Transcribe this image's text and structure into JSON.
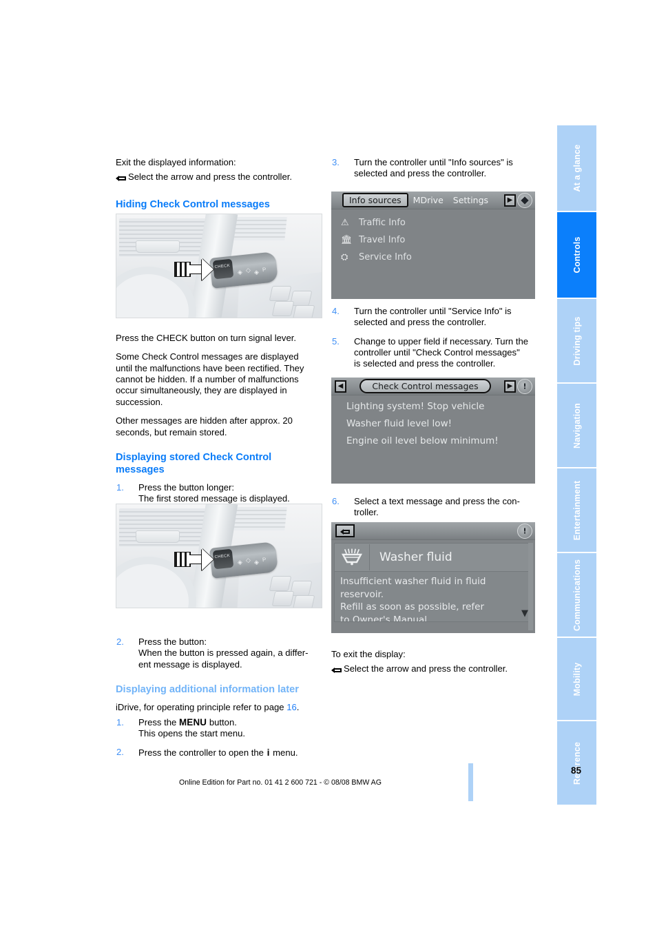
{
  "page": {
    "number": "85",
    "footer": "Online Edition for Part no. 01 41 2 600 721 - © 08/08 BMW AG"
  },
  "sidebar": {
    "tabs": [
      {
        "label": "At a glance",
        "active": false
      },
      {
        "label": "Controls",
        "active": true
      },
      {
        "label": "Driving tips",
        "active": false
      },
      {
        "label": "Navigation",
        "active": false
      },
      {
        "label": "Entertainment",
        "active": false
      },
      {
        "label": "Communications",
        "active": false
      },
      {
        "label": "Mobility",
        "active": false
      },
      {
        "label": "Reference",
        "active": false
      }
    ],
    "active_color": "#0b7ffb",
    "inactive_color": "#aed2f7"
  },
  "left_column": {
    "exit_intro": "Exit the displayed information:",
    "exit_action": "Select the arrow and press the controller.",
    "heading_hiding": "Hiding Check Control messages",
    "para_press_check": "Press the CHECK button on turn signal lever.",
    "para_some_messages": "Some Check Control messages are displayed until the malfunctions have been rectified. They cannot be hidden. If a number of malfunctions occur simultaneously, they are displayed in succession.",
    "para_other_messages": "Other messages are hidden after approx. 20 seconds, but remain stored.",
    "heading_displaying_stored": "Displaying stored Check Control messages",
    "steps_stored": [
      {
        "num": "1.",
        "line1": "Press the button longer:",
        "line2": "The first stored message is displayed."
      },
      {
        "num": "2.",
        "line1": "Press the button:",
        "line2": "When the button is pressed again, a differ-",
        "line3": "ent message is displayed."
      }
    ],
    "heading_additional": "Displaying additional information later",
    "para_idrive_pre": "iDrive, for operating principle refer to page ",
    "para_idrive_page": "16",
    "para_idrive_post": ".",
    "steps_additional": [
      {
        "num": "1.",
        "pre": "Press the ",
        "bold": "MENU",
        "post": " button.",
        "line2": "This opens the start menu."
      },
      {
        "num": "2.",
        "pre": "Press the controller to open the ",
        "bold": "i",
        "post": " menu."
      }
    ]
  },
  "right_column": {
    "steps": [
      {
        "num": "3.",
        "line1": "Turn the controller until \"Info sources\" is",
        "line2": "selected and press the controller."
      },
      {
        "num": "4.",
        "line1": "Turn the controller until \"Service Info\" is",
        "line2": "selected and press the controller."
      },
      {
        "num": "5.",
        "line1": "Change to upper field if necessary. Turn the",
        "line2": "controller until \"Check Control messages\"",
        "line3": "is selected and press the controller."
      },
      {
        "num": "6.",
        "line1": "Select a text message and press the con-",
        "line2": "troller."
      }
    ],
    "exit_intro": "To exit the display:",
    "exit_action": "Select the arrow and press the controller."
  },
  "idrive_screen_1": {
    "tabs": [
      {
        "label": "Info sources",
        "selected": true
      },
      {
        "label": "MDrive",
        "selected": false
      },
      {
        "label": "Settings",
        "selected": false
      }
    ],
    "right_arrow": "▶",
    "items": [
      {
        "icon": "traffic-info-icon",
        "glyph": "⚠",
        "label": "Traffic Info"
      },
      {
        "icon": "travel-info-icon",
        "glyph": "🏛",
        "label": "Travel Info"
      },
      {
        "icon": "service-info-icon",
        "glyph": "⛭",
        "label": "Service Info"
      }
    ]
  },
  "idrive_screen_2": {
    "left_arrow": "◀",
    "title": "Check Control messages",
    "right_arrow": "▶",
    "status_icon": "warning-circle-icon",
    "messages": [
      "Lighting system! Stop vehicle",
      "Washer fluid level low!",
      "Engine oil level below minimum!"
    ]
  },
  "idrive_screen_3": {
    "back_icon": "return-arrow-icon",
    "status_icon": "warning-circle-icon",
    "detail_icon": "washer-fluid-icon",
    "title": "Washer fluid",
    "body_lines": [
      "Insufficient washer fluid in fluid",
      "reservoir.",
      "Refill as soon as possible, refer",
      "to Owner's Manual."
    ],
    "scroll_down": "▼"
  },
  "figures": {
    "lever_1": {
      "alt": "Turn signal lever with CHECK button",
      "check_label": "CHECK"
    },
    "lever_2": {
      "alt": "Turn signal lever with CHECK button",
      "check_label": "CHECK"
    }
  }
}
